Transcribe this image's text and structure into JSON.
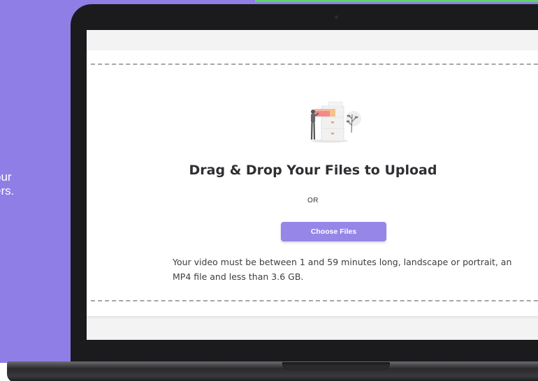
{
  "side_text": [
    "our",
    "ers."
  ],
  "upload": {
    "title": "Drag & Drop Your Files to Upload",
    "or_label": "OR",
    "choose_files_label": "Choose Files",
    "hint": "Your video must be between 1 and 59 minutes long, landscape or portrait, an MP4 file and less than 3.6 GB."
  },
  "colors": {
    "background": "#8f7ee6",
    "accent_green": "#5fd26a",
    "button": "#9686e8"
  },
  "icons": {
    "illustration": "person-with-file-cabinet-illustration"
  }
}
